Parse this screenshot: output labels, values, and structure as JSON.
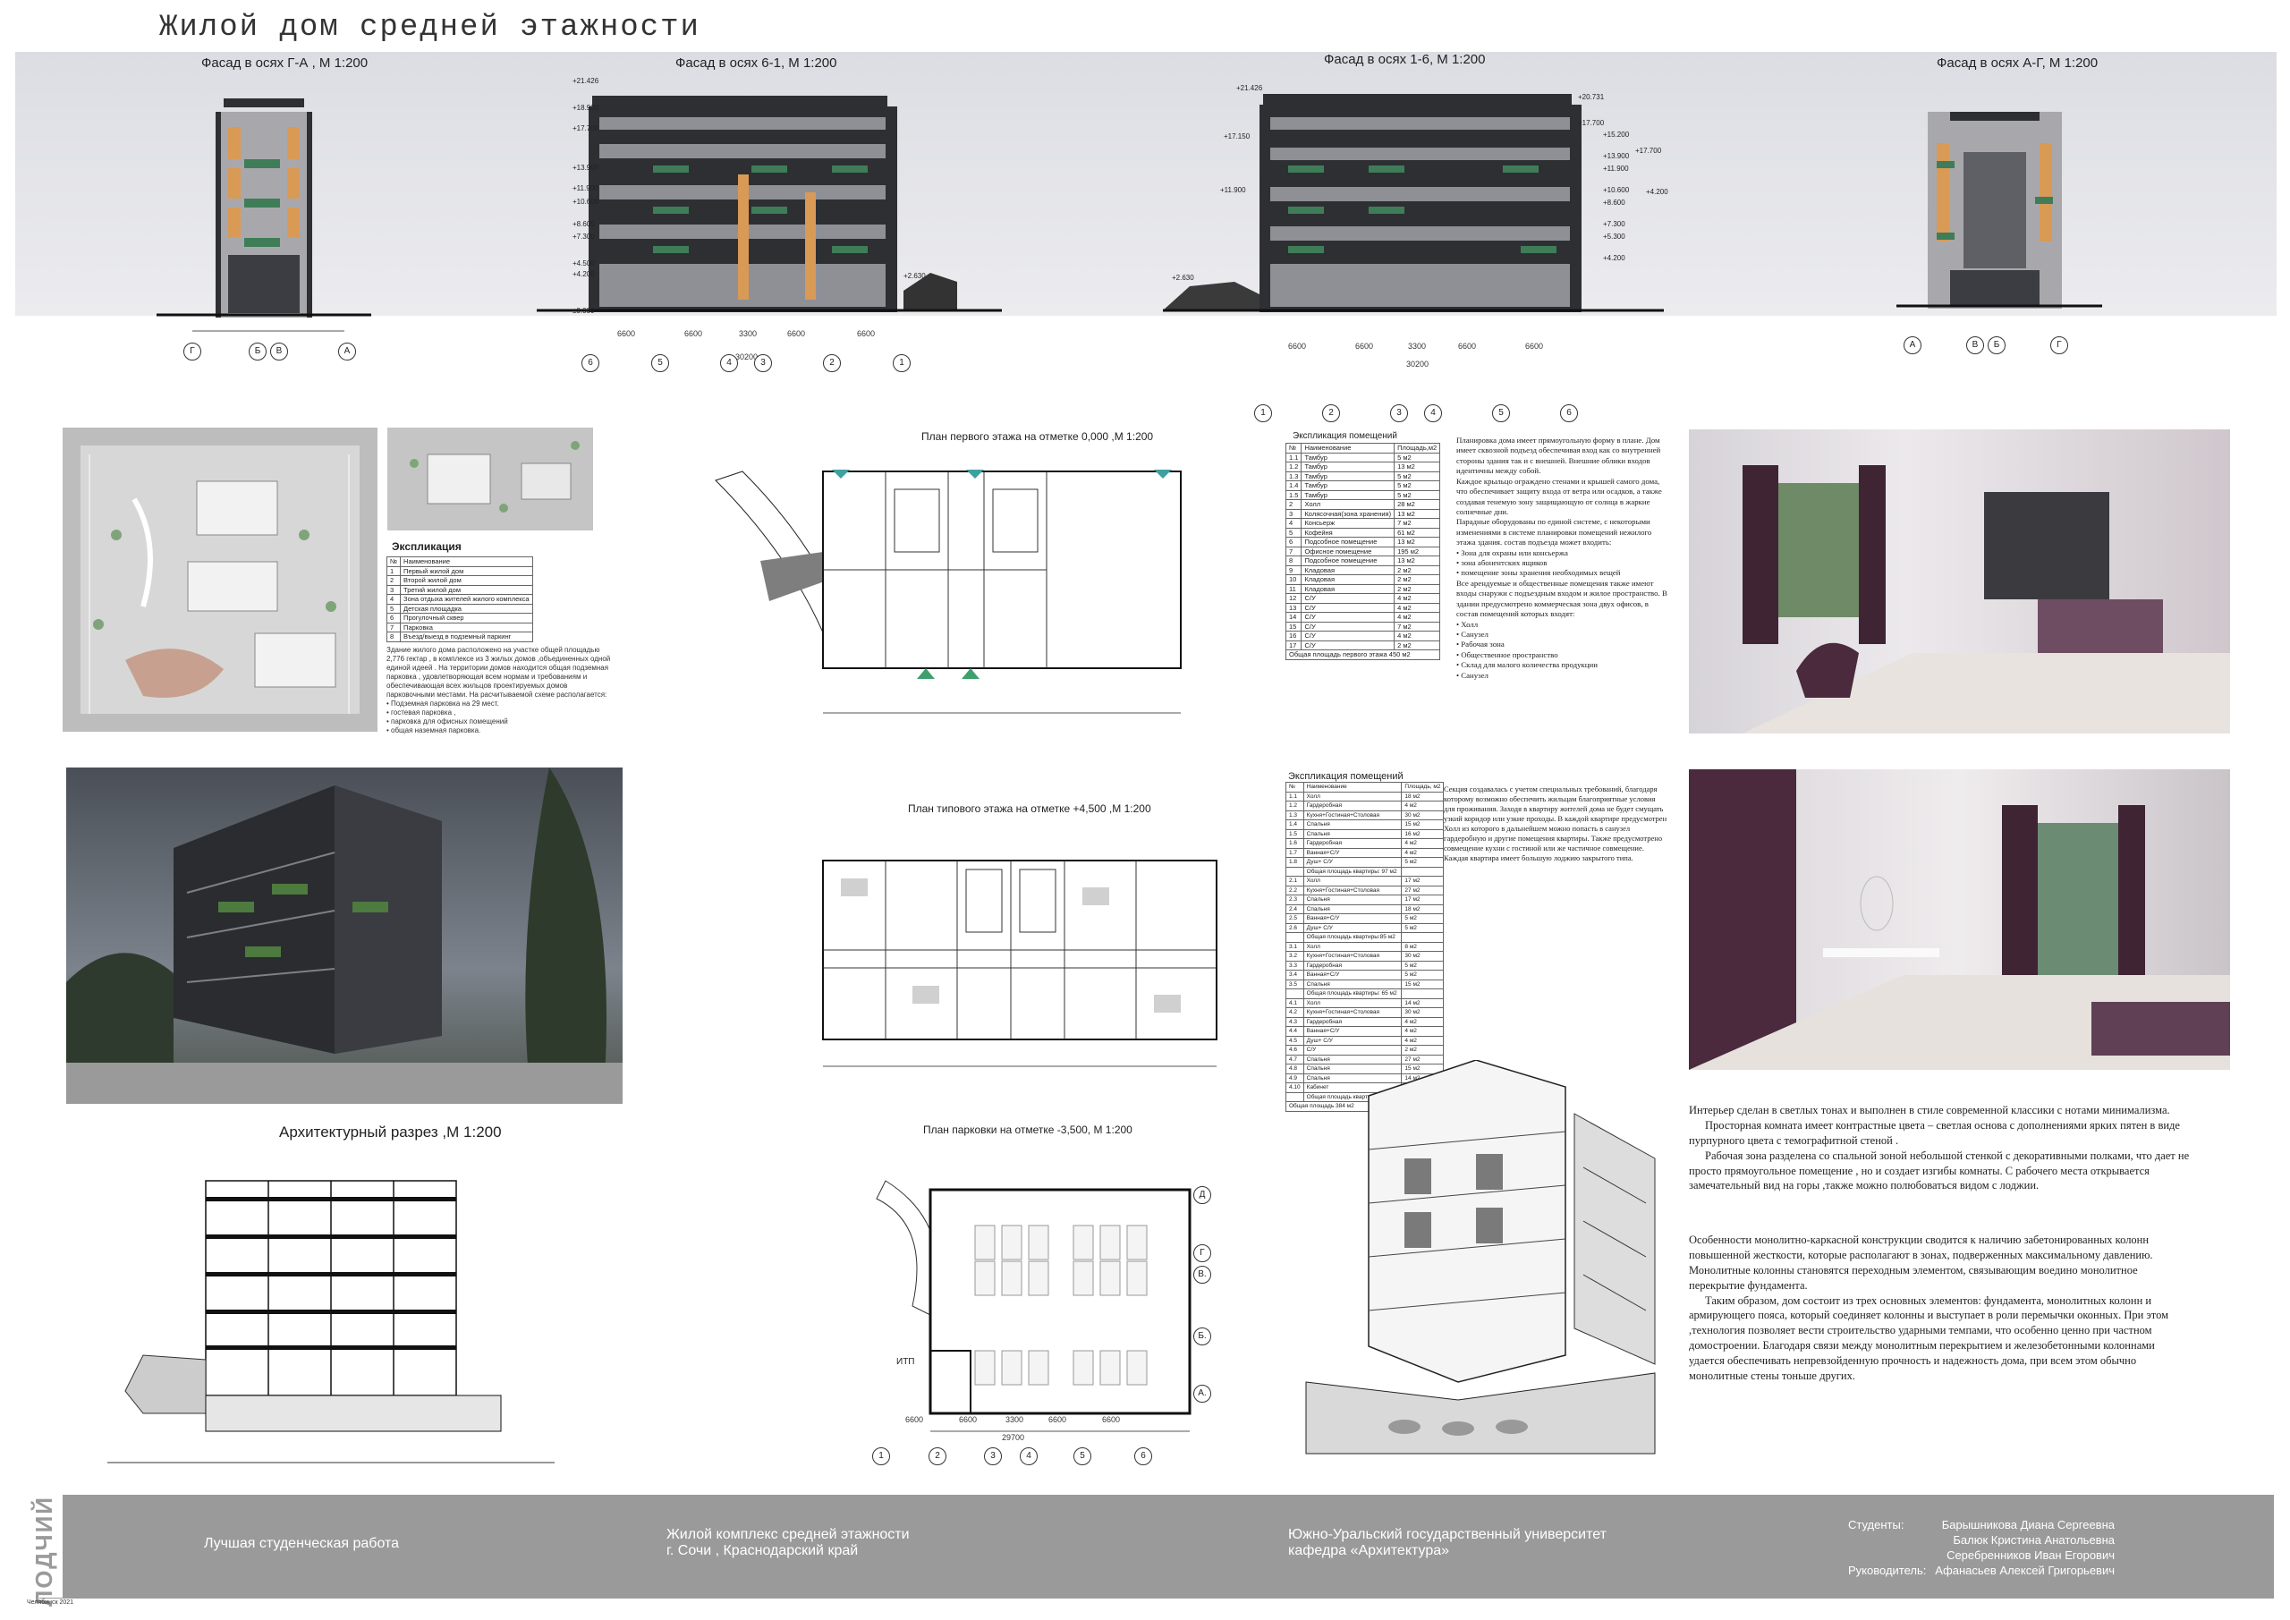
{
  "page_title": "Жилой дом средней этажности",
  "elevations": [
    {
      "caption": "Фасад в осях Г-А , М 1:200",
      "axes": [
        "Г",
        "Б",
        "В",
        "А"
      ]
    },
    {
      "caption": "Фасад в осях 6-1, М 1:200",
      "axes": [
        "6",
        "5",
        "4",
        "3",
        "2",
        "1"
      ],
      "dims": [
        "6600",
        "6600",
        "3300",
        "6600",
        "6600"
      ],
      "total": "30200",
      "levels": [
        "+21.426",
        "+18.900",
        "+17.700",
        "+13.900",
        "+11.900",
        "+10.600",
        "+8.600",
        "+7.300",
        "+4.500",
        "+4.200",
        "±0.000"
      ],
      "extra": "+2.630"
    },
    {
      "caption": "Фасад в осях 1-6, М 1:200",
      "axes": [
        "1",
        "2",
        "3",
        "4",
        "5",
        "6"
      ],
      "dims": [
        "6600",
        "6600",
        "3300",
        "6600",
        "6600"
      ],
      "total": "30200",
      "levels_left": [
        "+21.426",
        "+17.150",
        "+11.900",
        "+2.630"
      ],
      "levels_right": [
        "+20.731",
        "+17.700",
        "+15.200",
        "+13.900",
        "+11.900",
        "+10.600",
        "+8.600",
        "+7.300",
        "+5.300",
        "+4.200"
      ],
      "extra_right": [
        "+17.700",
        "+4.200"
      ]
    },
    {
      "caption": "Фасад в осях А-Г, М 1:200",
      "axes": [
        "А",
        "В",
        "Б",
        "Г"
      ]
    }
  ],
  "site": {
    "heading": "Экспликация",
    "table_rows": [
      [
        "№",
        "Наименование"
      ],
      [
        "1",
        "Первый жилой дом"
      ],
      [
        "2",
        "Второй жилой дом"
      ],
      [
        "3",
        "Третий жилой дом"
      ],
      [
        "4",
        "Зона отдыха жителей жилого комплекса"
      ],
      [
        "5",
        "Детская площадка"
      ],
      [
        "6",
        "Прогулочный сквер"
      ],
      [
        "7",
        "Парковка"
      ],
      [
        "8",
        "Въезд/выезд в подземный паркинг"
      ]
    ],
    "text": "Здание жилого дома расположено на участке общей площадью 2,776 гектар , в комплексе из 3 жилых домов ,объединенных одной единой идеей . На территории домов находится общая подземная парковка , удовлетворяющая всем нормам и требованиям и обеспечивающая всех жильцов проектируемых домов парковочными местами. На расчитываемой схеме располагается:",
    "list": [
      "• Подземная парковка на 29 мест.",
      "• гостевая парковка ,",
      "• парковка для офисных помещений",
      "• общая наземная парковка."
    ]
  },
  "plan1": {
    "caption": "План первого этажа на отметке 0,000 ,М 1:200",
    "axes_bottom": [
      "1",
      "2",
      "3",
      "4",
      "5",
      "6"
    ],
    "axes_left": [
      "Г",
      "В",
      "Б",
      "А"
    ]
  },
  "plan_typical": {
    "caption": "План типового этажа на отметке +4,500 ,М 1:200",
    "axes_bottom": [
      "1",
      "2",
      "3",
      "4",
      "5",
      "6"
    ]
  },
  "plan_parking": {
    "caption": "План парковки на отметке -3,500, М 1:200",
    "axes_bottom": [
      "1",
      "2",
      "3",
      "4",
      "5",
      "6"
    ],
    "axes_right": [
      "Д",
      "Г",
      "В.",
      "Б.",
      "А."
    ],
    "dims": [
      "6600",
      "6600",
      "3300",
      "6600",
      "6600"
    ],
    "total": "29700",
    "room": "ИТП"
  },
  "section": {
    "caption": "Архитектурный разрез ,М 1:200"
  },
  "expl1": {
    "heading": "Экспликация помещений",
    "header": [
      "№",
      "Наименование",
      "Площадь,м2"
    ],
    "rows": [
      [
        "1.1",
        "Тамбур",
        "5 м2"
      ],
      [
        "1.2",
        "Тамбур",
        "13 м2"
      ],
      [
        "1.3",
        "Тамбур",
        "5 м2"
      ],
      [
        "1.4",
        "Тамбур",
        "5 м2"
      ],
      [
        "1.5",
        "Тамбур",
        "5 м2"
      ],
      [
        "2",
        "Холл",
        "28 м2"
      ],
      [
        "3",
        "Колясочная(зона хранения)",
        "13 м2"
      ],
      [
        "4",
        "Консьерж",
        "7 м2"
      ],
      [
        "5",
        "Кофейня",
        "61 м2"
      ],
      [
        "6",
        "Подсобное помещение",
        "13 м2"
      ],
      [
        "7",
        "Офисное помещение",
        "195 м2"
      ],
      [
        "8",
        "Подсобное помещение",
        "13 м2"
      ],
      [
        "9",
        "Кладовая",
        "2 м2"
      ],
      [
        "10",
        "Кладовая",
        "2 м2"
      ],
      [
        "11",
        "Кладовая",
        "2 м2"
      ],
      [
        "12",
        "С/У",
        "4 м2"
      ],
      [
        "13",
        "С/У",
        "4 м2"
      ],
      [
        "14",
        "С/У",
        "4 м2"
      ],
      [
        "15",
        "С/У",
        "7 м2"
      ],
      [
        "16",
        "С/У",
        "4 м2"
      ],
      [
        "17",
        "С/У",
        "2 м2"
      ]
    ],
    "total": "Общая площадь первого этажа 450 м2"
  },
  "plan_text": {
    "paragraphs": [
      "Планировка дома имеет прямоугольную форму в плане. Дом имеет сквозной подъезд обеспечивая вход как со внутренней стороны здания так и с внешней. Внешние облики входов идентичны между собой.",
      "Каждое крыльцо ограждено стенами и крышей самого дома, что обеспечивает защиту входа от ветра или осадков, а также создавая тенемую зону защищающую от солнца в жаркие солнечные дни.",
      "Парадные оборудованы по единой системе, с некоторыми изменениями в системе планировки помещений нежилого этажа здания. состав подъезда может входить:"
    ],
    "list1": [
      "• Зона для охраны или консьержа",
      "• зона абонентских ящиков",
      "• помещение зоны хранения необходимых вещей"
    ],
    "paragraph2": "Все арендуемые и общественные помещения также имеют входы снаружи с подъездным входом и жилое пространство. В здании предусмотрено коммерческая зона двух офисов, в состав помещений которых входят:",
    "list2": [
      "• Холл",
      "• Санузел",
      "• Рабочая зона",
      "• Общественное пространство",
      "• Склад для малого количества продукции",
      "• Санузел"
    ]
  },
  "expl2": {
    "heading": "Экспликация помещений",
    "header": [
      "№",
      "Наименование",
      "Площадь, м2"
    ],
    "rows": [
      [
        "1.1",
        "Холл",
        "18 м2"
      ],
      [
        "1.2",
        "Гардеробная",
        "4 м2"
      ],
      [
        "1.3",
        "Кухня+Гостиная+Столовая",
        "30 м2"
      ],
      [
        "1.4",
        "Спальня",
        "15 м2"
      ],
      [
        "1.5",
        "Спальня",
        "16 м2"
      ],
      [
        "1.6",
        "Гардеробная",
        "4 м2"
      ],
      [
        "1.7",
        "Ванная+С/У",
        "4 м2"
      ],
      [
        "1.8",
        "Душ+ С/У",
        "5 м2"
      ],
      [
        "",
        "Общая площадь квартиры: 97 м2",
        ""
      ],
      [
        "2.1",
        "Холл",
        "17 м2"
      ],
      [
        "2.2",
        "Кухня+Гостиная+Столовая",
        "27 м2"
      ],
      [
        "2.3",
        "Спальня",
        "17 м2"
      ],
      [
        "2.4",
        "Спальня",
        "18 м2"
      ],
      [
        "2.5",
        "Ванная+С/У",
        "5 м2"
      ],
      [
        "2.6",
        "Душ+ С/У",
        "5 м2"
      ],
      [
        "",
        "Общая площадь квартиры:85 м2",
        ""
      ],
      [
        "3.1",
        "Холл",
        "8 м2"
      ],
      [
        "3.2",
        "Кухня+Гостиная+Столовая",
        "30 м2"
      ],
      [
        "3.3",
        "Гардеробная",
        "5 м2"
      ],
      [
        "3.4",
        "Ванная+С/У",
        "5 м2"
      ],
      [
        "3.5",
        "Спальня",
        "15 м2"
      ],
      [
        "",
        "Общая площадь квартиры: 65 м2",
        ""
      ],
      [
        "4.1",
        "Холл",
        "14 м2"
      ],
      [
        "4.2",
        "Кухня+Гостиная+Столовая",
        "30 м2"
      ],
      [
        "4.3",
        "Гардеробная",
        "4 м2"
      ],
      [
        "4.4",
        "Ванная+С/У",
        "4 м2"
      ],
      [
        "4.5",
        "Душ+ С/У",
        "4 м2"
      ],
      [
        "4.6",
        "С/У",
        "2 м2"
      ],
      [
        "4.7",
        "Спальня",
        "27 м2"
      ],
      [
        "4.8",
        "Спальня",
        "15 м2"
      ],
      [
        "4.9",
        "Спальня",
        "14 м2"
      ],
      [
        "4.10",
        "Кабинет",
        "14 м2"
      ],
      [
        "",
        "Общая площадь квартиры:137 м2",
        ""
      ]
    ],
    "total": "Общая площадь 384 м2"
  },
  "typical_text": "Секция создавалась с учетом специальных требований, благодаря которому возможно обеспечить жильцам благоприятные условия для проживания. Заходя в квартиру жителей дома не будет смущать узкий коридор или узкие проходы. В каждой квартире предусмотрен Холл из которого в дальнейшем можно попасть в санузел гардеробную и другие помещения квартиры. Также предусмотрено совмещение кухни с гостиной или же частичное совмещение. Каждая квартира имеет большую лоджию закрытого типа.",
  "interior_text": [
    "Интерьер сделан в светлых тонах и выполнен в стиле современной классики с нотами минимализма.",
    "Просторная комната имеет контрастные цвета – светлая основа с дополнениями ярких пятен в виде пурпурного цвета с темографитной стеной .",
    "Рабочая зона разделена со спальной зоной небольшой стенкой с декоративными полками, что дает не просто прямоугольное помещение , но и создает изгибы комнаты. С рабочего места открывается замечательный вид на горы ,также можно полюбоваться видом с лоджии."
  ],
  "structure_text": [
    "Особенности монолитно-каркасной конструкции сводится к наличию забетонированных колонн повышенной жесткости, которые располагают в зонах, подверженных максимальному давлению. Монолитные колонны становятся переходным элементом, связывающим воедино монолитное перекрытие фундамента.",
    "Таким образом, дом состоит из трех основных элементов: фундамента, монолитных колонн и армирующего пояса, который соединяет колонны и выступает в роли перемычки оконных. При этом ,технология позволяет вести строительство ударными темпами, что особенно ценно при частном домостроении. Благодаря связи между монолитным перекрытием и железобетонными колоннами удается обеспечивать непревзойденную прочность и надежность дома, при всем этом обычно монолитные стены тоньше других."
  ],
  "footer": {
    "award": "Лучшая студенческая работа",
    "project_line1": "Жилой комплекс средней этажности",
    "project_line2": "г. Сочи , Краснодарский край",
    "uni_line1": "Южно-Уральский государственный университет",
    "uni_line2": "кафедра «Архитектура»",
    "students_label": "Студенты:",
    "students": [
      "Барышникова Диана Сергеевна",
      "Балюк Кристина Анатольевна",
      "Серебренников Иван Егорович"
    ],
    "supervisor_label": "Руководитель:",
    "supervisor": "Афанасьев Алексей Григорьевич",
    "logo_text": "ЛОДЧИЙ",
    "logo_sub": "Челябинск 2021"
  },
  "colors": {
    "facade_dark": "#2d2f33",
    "facade_grey": "#a9a9ad",
    "accent_orange": "#d89a55",
    "accent_green": "#3f7d58",
    "plum": "#4a2a3c",
    "footer": "#9a9a9a"
  }
}
